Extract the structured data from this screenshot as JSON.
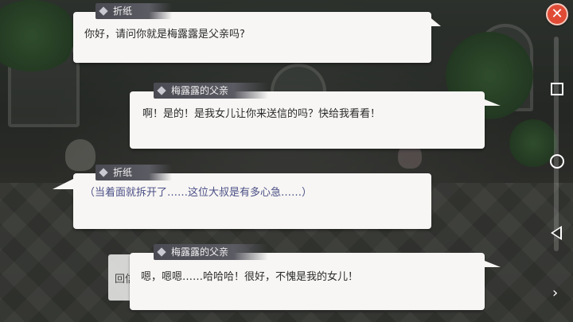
{
  "dialogue": [
    {
      "speaker": "折纸",
      "text": "你好，请问你就是梅露露是父亲吗?"
    },
    {
      "speaker": "梅露露的父亲",
      "text": "啊！是的！是我女儿让你来送信的吗？快给我看看！"
    },
    {
      "speaker": "折纸",
      "text": "（当着面就拆开了……这位大叔是有多心急……）"
    },
    {
      "speaker": "梅露露的父亲",
      "text": "嗯，嗯嗯……哈哈哈！很好，不愧是我的女儿！"
    }
  ],
  "hidden_box_text": "回信",
  "buttons": {
    "close": "✕",
    "next": "›"
  },
  "icons": {
    "close": "close-icon",
    "recent": "recent-apps-icon",
    "home": "home-icon",
    "back": "back-icon",
    "next": "chevron-right-icon"
  },
  "colors": {
    "close_button": "#e04b35",
    "bubble": "#f7f6f4",
    "name_tag": "#4a4a52",
    "narration_text": "#4b4f86"
  }
}
